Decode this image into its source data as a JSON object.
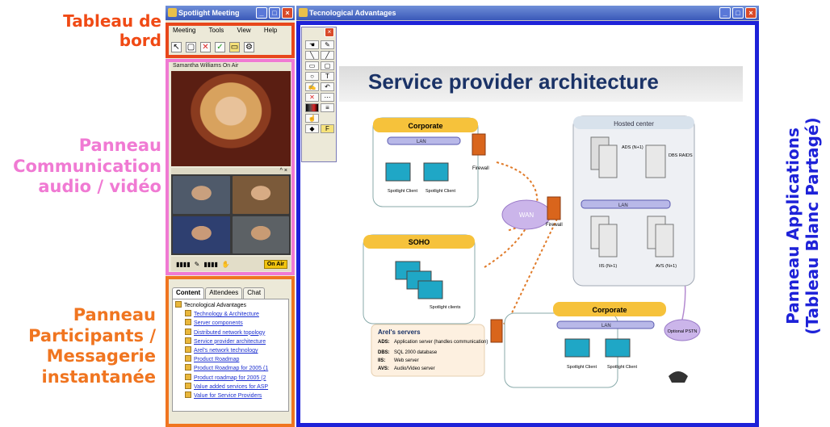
{
  "annotations": {
    "board": [
      "Tableau de",
      "bord"
    ],
    "comm": [
      "Panneau",
      "Communication",
      "audio / vidéo"
    ],
    "participants": [
      "Panneau",
      "Participants /",
      "Messagerie",
      "instantanée"
    ],
    "applications": [
      "Panneau Applications",
      "(Tableau Blanc Partagé)"
    ]
  },
  "left_window": {
    "title": "Spotlight Meeting",
    "menu": [
      "Meeting",
      "Tools",
      "View",
      "Help"
    ],
    "speaker": "Samantha  Williams  On Air",
    "on_air": "On Air",
    "tabs": [
      "Content",
      "Attendees",
      "Chat"
    ],
    "tree_root": "Tecnological Advantages",
    "tree_items": [
      "Technology & Architecture",
      "Server components",
      "Distributed network topology",
      "Service provider architecture",
      "Arel's network technology",
      "Product Roadmap",
      "Product Roadmap for 2005 (1",
      "Product roadmap for 2005 (2",
      "Value added services for ASP",
      "Value for Service Providers"
    ]
  },
  "right_window": {
    "title": "Tecnological Advantages",
    "slide_title": "Service provider architecture",
    "diagram": {
      "corporate_top": "Corporate",
      "hosted": "Hosted center",
      "soho": "SOHO",
      "corporate_bottom": "Corporate",
      "lan": "LAN",
      "wan": "WAN",
      "firewall": "Firewall",
      "spotlight_client": "Spotlight Client",
      "spotlight_clients": "Spotlight clients",
      "ads": "ADS (N+1)",
      "dbs": "DBS RAIDS",
      "iis": "IIS (N+1)",
      "avs": "AVS (N+1)",
      "pstn": "Optional PSTN",
      "servers_title": "Arel's servers",
      "servers": [
        {
          "k": "ADS:",
          "v": "Application server (handles communication)"
        },
        {
          "k": "DBS:",
          "v": "SQL 2000 database"
        },
        {
          "k": "IIS:",
          "v": "Web server"
        },
        {
          "k": "AVS:",
          "v": "Audio/Video server"
        }
      ]
    }
  }
}
